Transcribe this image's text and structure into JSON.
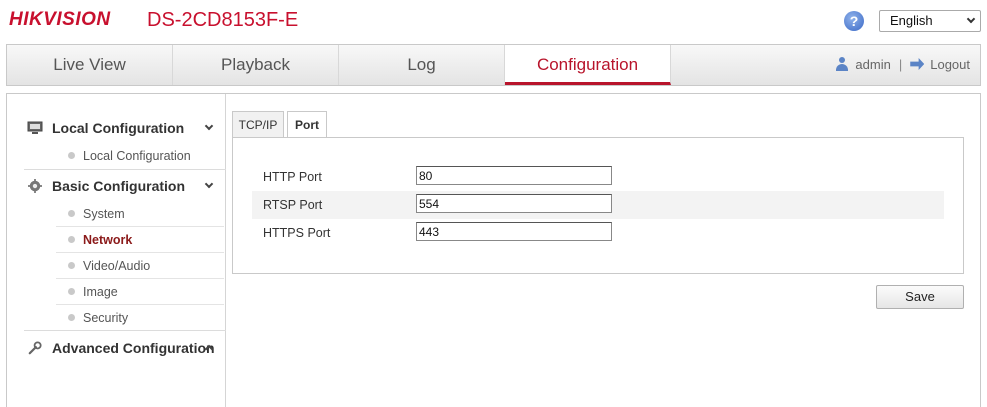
{
  "header": {
    "brand": "HIKVISION",
    "model": "DS-2CD8153F-E",
    "help_icon": "help-icon",
    "help_glyph": "?",
    "language": "English"
  },
  "nav": {
    "tabs": [
      {
        "label": "Live View",
        "active": false
      },
      {
        "label": "Playback",
        "active": false
      },
      {
        "label": "Log",
        "active": false
      },
      {
        "label": "Configuration",
        "active": true
      }
    ],
    "user": "admin",
    "separator": "|",
    "logout": "Logout"
  },
  "sidebar": {
    "groups": [
      {
        "label": "Local Configuration",
        "icon": "monitor-icon",
        "expanded": true,
        "items": [
          {
            "label": "Local Configuration",
            "active": false
          }
        ]
      },
      {
        "label": "Basic Configuration",
        "icon": "gear-icon",
        "expanded": true,
        "items": [
          {
            "label": "System",
            "active": false
          },
          {
            "label": "Network",
            "active": true
          },
          {
            "label": "Video/Audio",
            "active": false
          },
          {
            "label": "Image",
            "active": false
          },
          {
            "label": "Security",
            "active": false
          }
        ]
      },
      {
        "label": "Advanced Configuration",
        "icon": "wrench-icon",
        "expanded": false,
        "items": []
      }
    ]
  },
  "content": {
    "subtabs": [
      {
        "label": "TCP/IP",
        "active": false
      },
      {
        "label": "Port",
        "active": true
      }
    ],
    "fields": [
      {
        "label": "HTTP Port",
        "value": "80"
      },
      {
        "label": "RTSP Port",
        "value": "554"
      },
      {
        "label": "HTTPS Port",
        "value": "443"
      }
    ],
    "save_label": "Save"
  },
  "colors": {
    "brand": "#c8102e",
    "active_tab": "#b8142b",
    "active_item": "#8b1a1a",
    "icon_blue": "#5b84c6"
  }
}
